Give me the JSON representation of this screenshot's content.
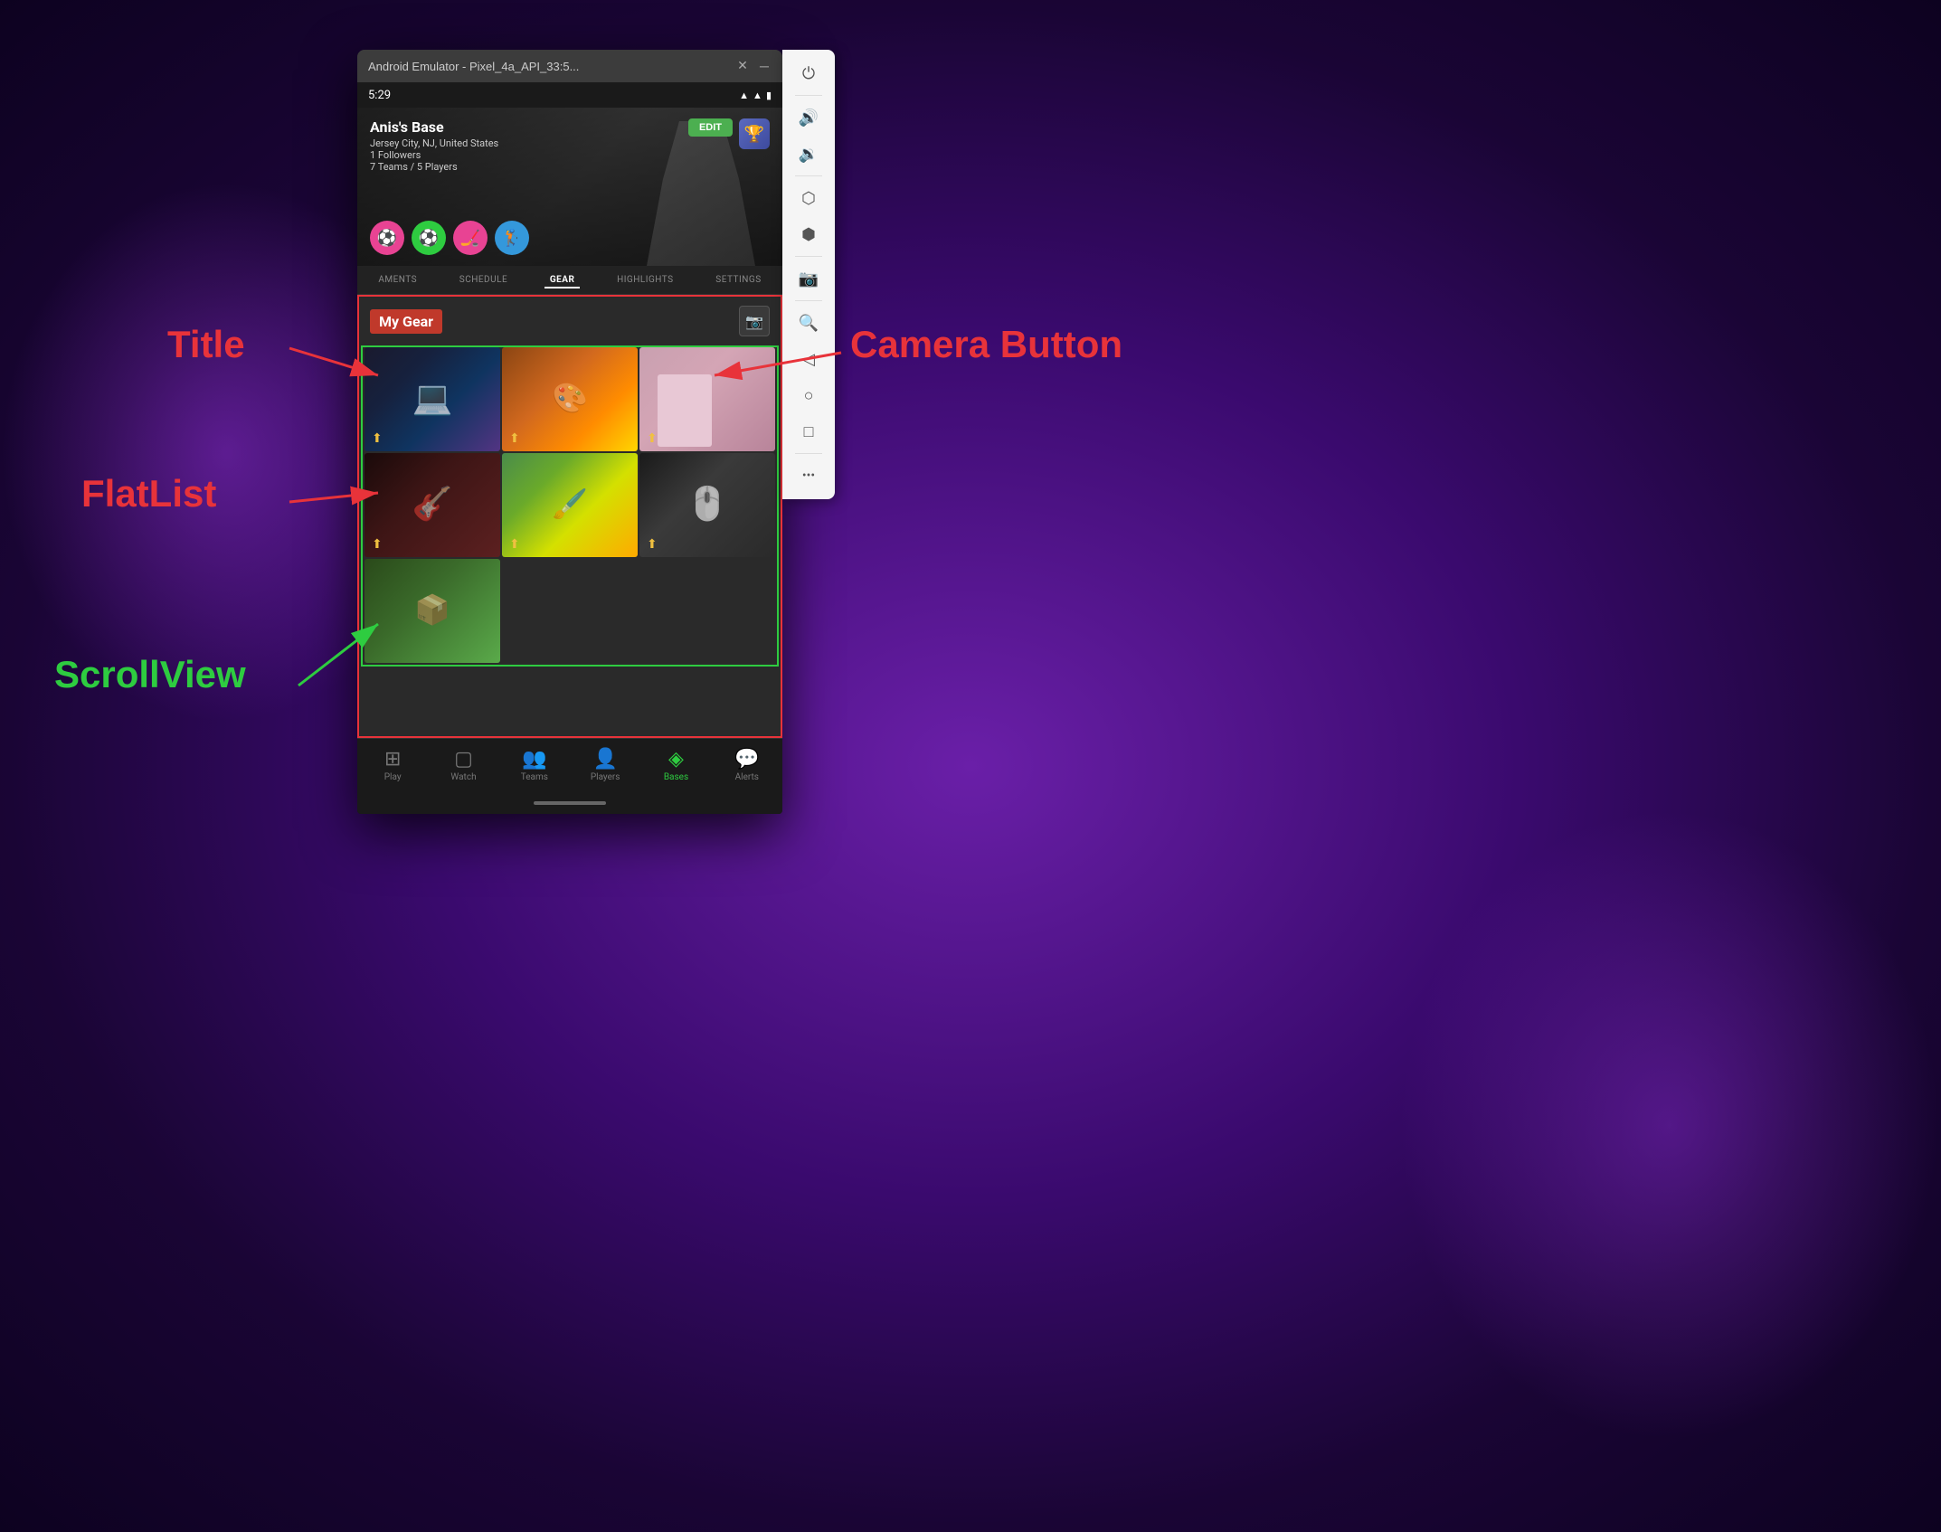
{
  "window": {
    "title": "Android Emulator - Pixel_4a_API_33:5...",
    "close_btn": "✕",
    "minimize_btn": "─"
  },
  "status_bar": {
    "time": "5:29",
    "wifi_icon": "▲",
    "signal_icon": "▲",
    "battery_icon": "▮"
  },
  "profile": {
    "name": "Anis's Base",
    "location": "Jersey City, NJ, United States",
    "followers": "1 Followers",
    "teams_players": "7 Teams / 5 Players",
    "edit_label": "EDIT"
  },
  "tabs": {
    "items": [
      {
        "label": "AMENTS",
        "active": false
      },
      {
        "label": "SCHEDULE",
        "active": false
      },
      {
        "label": "GEAR",
        "active": true
      },
      {
        "label": "HIGHLIGHTS",
        "active": false
      },
      {
        "label": "SETTINGS",
        "active": false
      }
    ]
  },
  "gear": {
    "title": "My Gear",
    "camera_icon": "📷",
    "images": [
      {
        "type": "laptop",
        "alt": "Laptop setup"
      },
      {
        "type": "art1",
        "alt": "Art materials"
      },
      {
        "type": "pink",
        "alt": "Pink item"
      },
      {
        "type": "dark",
        "alt": "Dark instrument"
      },
      {
        "type": "art2",
        "alt": "Colorful art"
      },
      {
        "type": "device",
        "alt": "Device"
      },
      {
        "type": "last",
        "alt": "Package"
      }
    ],
    "share_icon": "⬆"
  },
  "bottom_nav": {
    "items": [
      {
        "label": "Play",
        "icon": "⊞",
        "active": false
      },
      {
        "label": "Watch",
        "icon": "▢",
        "active": false
      },
      {
        "label": "Teams",
        "icon": "👥",
        "active": false
      },
      {
        "label": "Players",
        "icon": "👤",
        "active": false
      },
      {
        "label": "Bases",
        "icon": "◈",
        "active": true
      },
      {
        "label": "Alerts",
        "icon": "💬",
        "active": false
      }
    ]
  },
  "annotations": {
    "title_label": "Title",
    "camera_label": "Camera Button",
    "flatlist_label": "FlatList",
    "scrollview_label": "ScrollView"
  },
  "toolbar": {
    "buttons": [
      {
        "icon": "⏻",
        "name": "power"
      },
      {
        "icon": "🔊",
        "name": "volume-up"
      },
      {
        "icon": "🔉",
        "name": "volume-down"
      },
      {
        "icon": "⬡",
        "name": "rotate"
      },
      {
        "icon": "⬢",
        "name": "rotate-alt"
      },
      {
        "icon": "📷",
        "name": "screenshot"
      },
      {
        "icon": "🔍",
        "name": "zoom"
      },
      {
        "icon": "◁",
        "name": "back"
      },
      {
        "icon": "○",
        "name": "home"
      },
      {
        "icon": "□",
        "name": "recents"
      },
      {
        "icon": "•••",
        "name": "more"
      }
    ]
  }
}
